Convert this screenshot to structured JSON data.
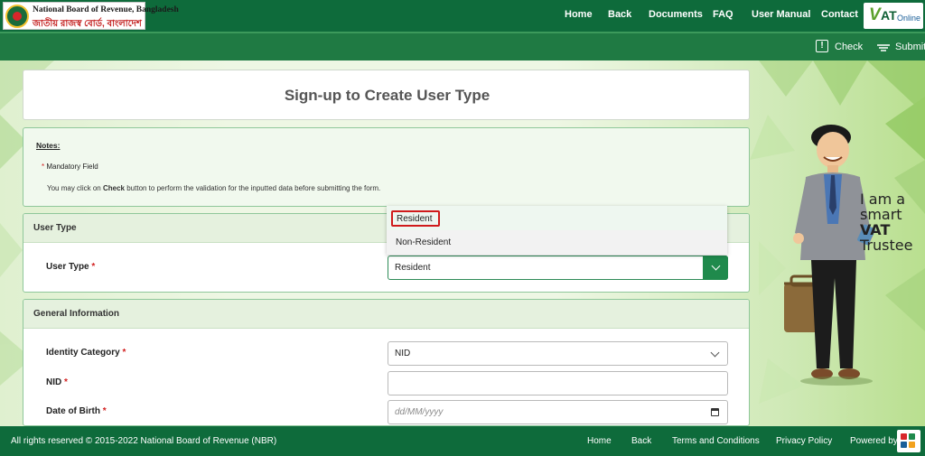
{
  "header": {
    "logo_en": "National Board of Revenue, Bangladesh",
    "logo_bn": "জাতীয় রাজস্ব বোর্ড, বাংলাদেশ",
    "nav": [
      "Home",
      "Back",
      "Documents",
      "FAQ",
      "User Manual",
      "Contact"
    ],
    "vat_logo": {
      "v": "V",
      "at": "AT",
      "online": "Online"
    }
  },
  "actions": {
    "check": "Check",
    "submit": "Submit"
  },
  "page": {
    "title": "Sign-up to Create User Type"
  },
  "notes": {
    "heading": "Notes:",
    "mandatory_marker": "*",
    "mandatory_text": "Mandatory Field",
    "instruction_pre": "You may click on",
    "instruction_bold": "Check",
    "instruction_post": "button to perform the validation for the inputted data before submitting the form."
  },
  "user_type_section": {
    "heading": "User Type",
    "label": "User Type",
    "required": "*",
    "value": "Resident",
    "options": [
      "Resident",
      "Non-Resident"
    ],
    "highlighted_option": "Resident"
  },
  "general_section": {
    "heading": "General Information",
    "identity_category": {
      "label": "Identity Category",
      "required": "*",
      "value": "NID"
    },
    "nid": {
      "label": "NID",
      "required": "*",
      "value": ""
    },
    "dob": {
      "label": "Date of Birth",
      "required": "*",
      "placeholder": "dd/MM/yyyy"
    }
  },
  "mascot": {
    "slogan": [
      "I am a",
      "smart",
      "VAT",
      "Trustee"
    ]
  },
  "footer": {
    "copyright": "All rights reserved © 2015-2022 National Board of Revenue (NBR)",
    "links": [
      "Home",
      "Back",
      "Terms and Conditions",
      "Privacy Policy"
    ],
    "powered_by": "Powered by"
  },
  "colors": {
    "brand_green": "#0e6b3b",
    "accent_green": "#1f8a4c",
    "highlight_red": "#d01b1b"
  }
}
